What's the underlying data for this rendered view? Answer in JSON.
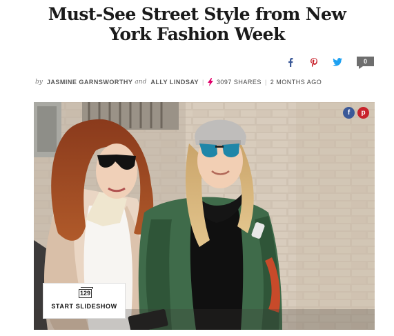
{
  "article": {
    "title": "Must-See Street Style from New York Fashion Week",
    "byline": {
      "by": "by",
      "author1": "JASMINE GARNSWORTHY",
      "and": "and",
      "author2": "ALLY LINDSAY",
      "shares": "3097 SHARES",
      "time": "2 MONTHS AGO"
    }
  },
  "share": {
    "facebook_icon": "facebook-icon",
    "pinterest_icon": "pinterest-icon",
    "twitter_icon": "twitter-icon",
    "comment_count": "0"
  },
  "hero": {
    "image": "two-women-street-style-photo",
    "mini_share": {
      "facebook": "f",
      "pinterest": "p"
    }
  },
  "slideshow": {
    "count": "129",
    "label": "START SLIDESHOW"
  },
  "colors": {
    "facebook": "#3b5998",
    "pinterest": "#c8232c",
    "twitter": "#1da1f2",
    "accent": "#e0006a"
  }
}
